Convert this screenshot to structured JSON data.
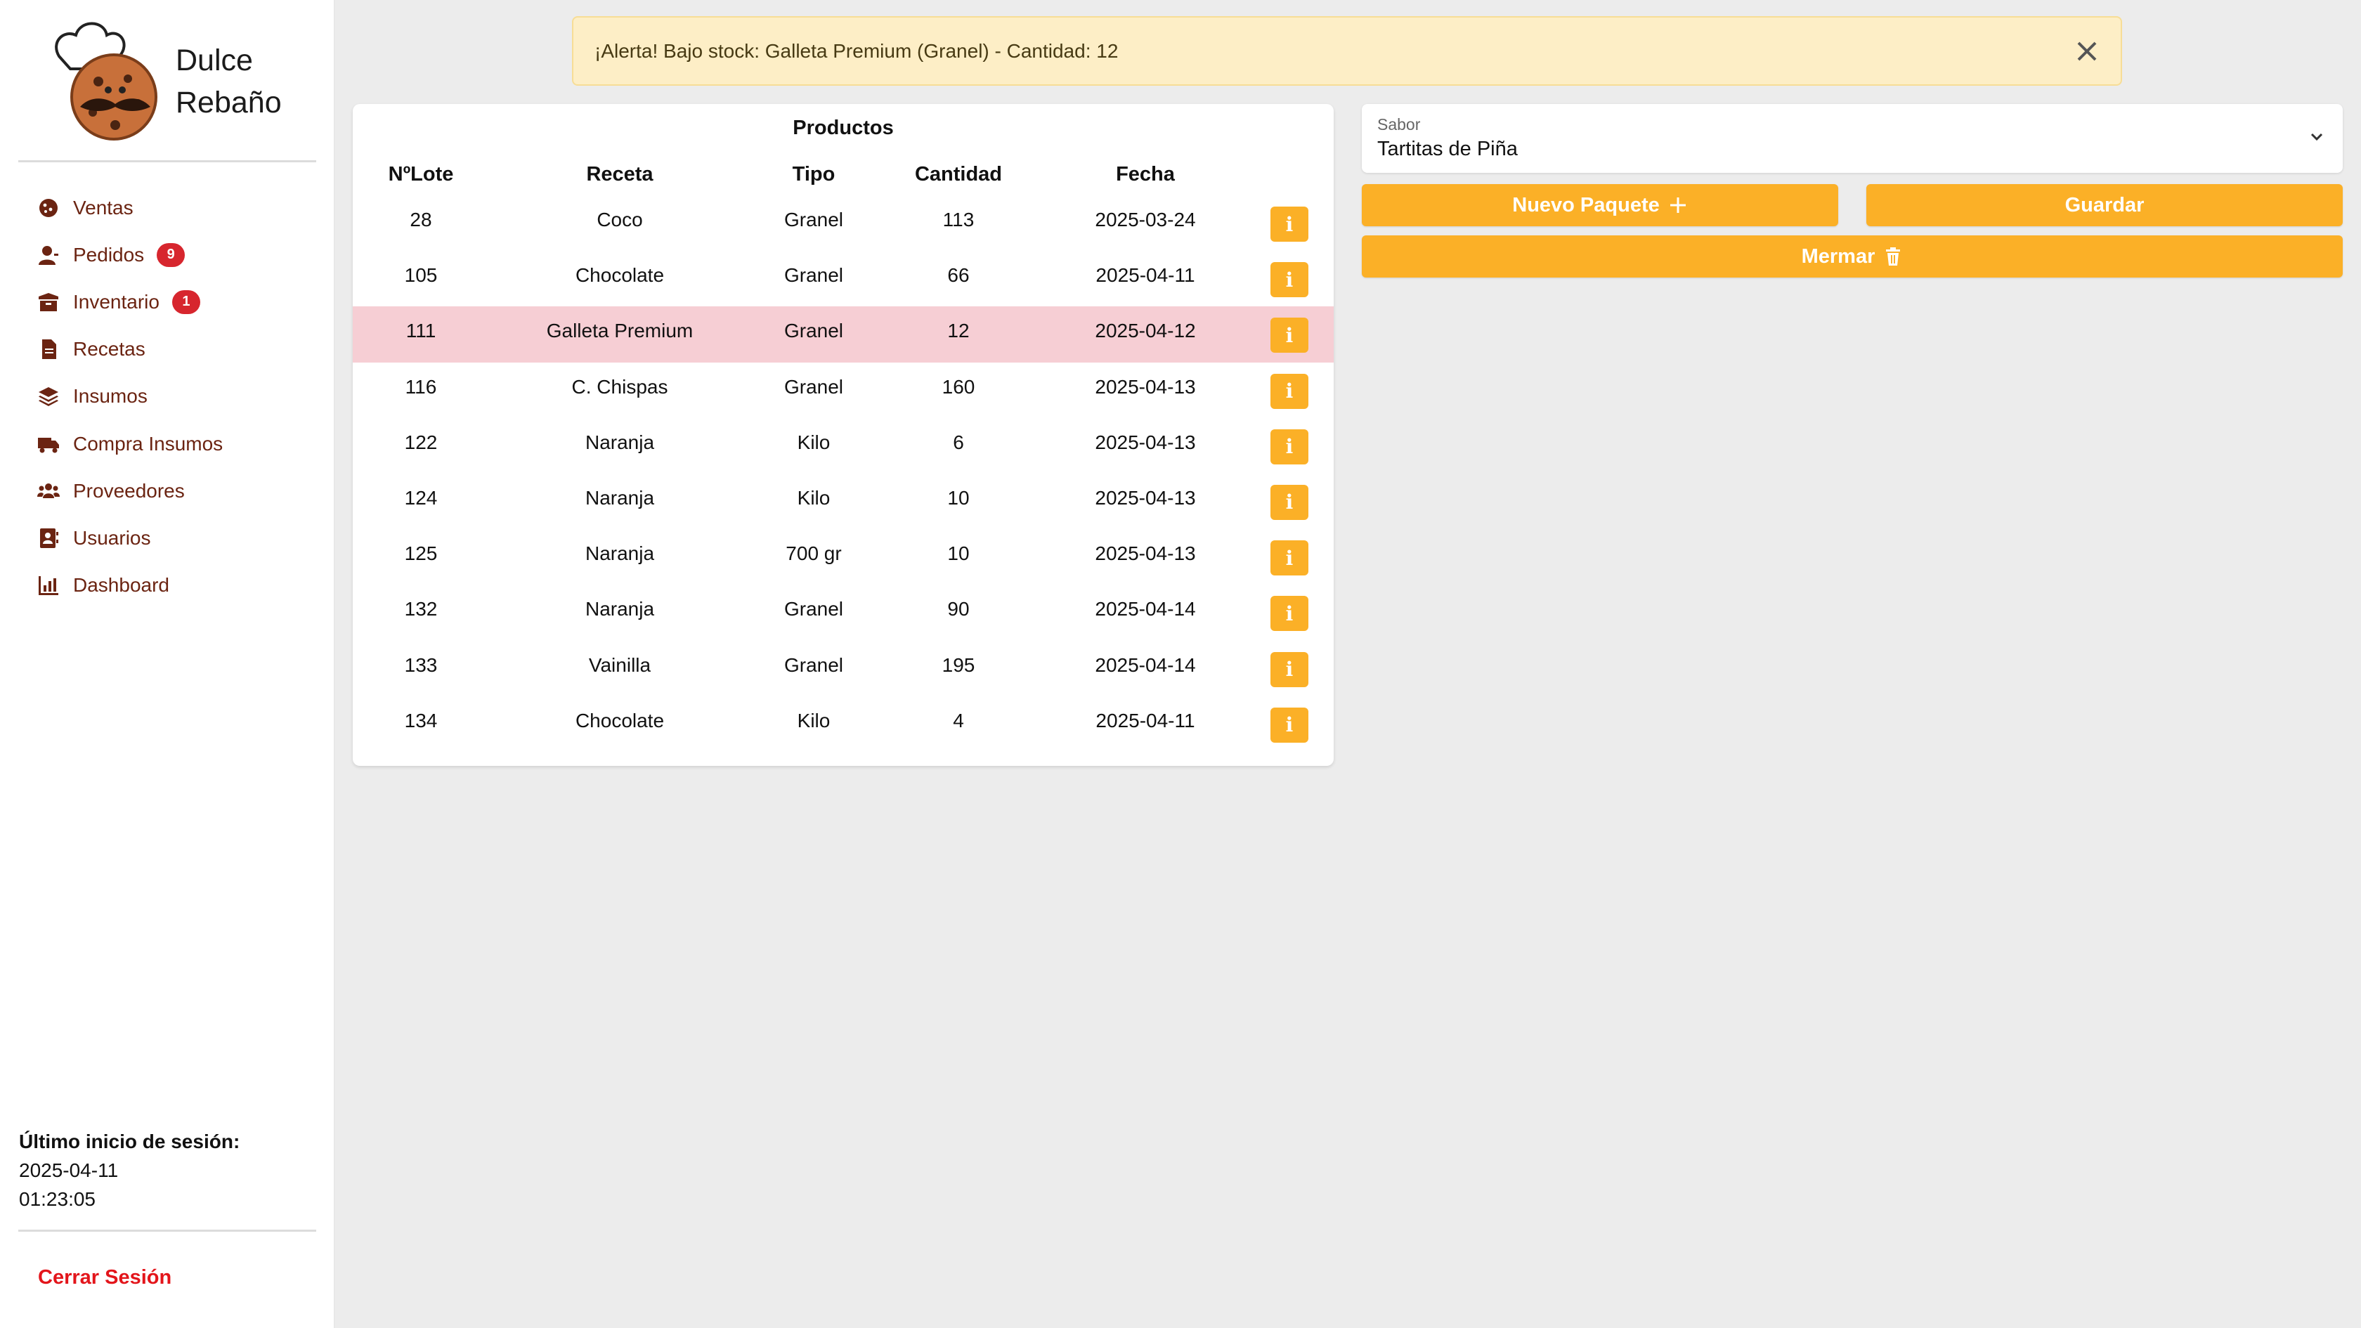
{
  "brand": {
    "line1": "Dulce",
    "line2": "Rebaño"
  },
  "nav": [
    {
      "label": "Ventas",
      "icon": "cookie-icon"
    },
    {
      "label": "Pedidos",
      "icon": "user-icon",
      "badge": "9"
    },
    {
      "label": "Inventario",
      "icon": "box-icon",
      "badge": "1"
    },
    {
      "label": "Recetas",
      "icon": "document-icon"
    },
    {
      "label": "Insumos",
      "icon": "layers-icon"
    },
    {
      "label": "Compra Insumos",
      "icon": "truck-icon"
    },
    {
      "label": "Proveedores",
      "icon": "users-icon"
    },
    {
      "label": "Usuarios",
      "icon": "address-book-icon"
    },
    {
      "label": "Dashboard",
      "icon": "chart-icon"
    }
  ],
  "session": {
    "title": "Último inicio de sesión:",
    "date": "2025-04-11",
    "time": "01:23:05"
  },
  "logout": "Cerrar Sesión",
  "alert": {
    "text": "¡Alerta! Bajo stock: Galleta Premium (Granel) - Cantidad: 12"
  },
  "table": {
    "title": "Productos",
    "headers": [
      "NºLote",
      "Receta",
      "Tipo",
      "Cantidad",
      "Fecha"
    ],
    "info_label": "i",
    "rows": [
      {
        "lote": "28",
        "receta": "Coco",
        "tipo": "Granel",
        "cantidad": "113",
        "fecha": "2025-03-24"
      },
      {
        "lote": "105",
        "receta": "Chocolate",
        "tipo": "Granel",
        "cantidad": "66",
        "fecha": "2025-04-11"
      },
      {
        "lote": "111",
        "receta": "Galleta Premium",
        "tipo": "Granel",
        "cantidad": "12",
        "fecha": "2025-04-12",
        "low_stock": true
      },
      {
        "lote": "116",
        "receta": "C. Chispas",
        "tipo": "Granel",
        "cantidad": "160",
        "fecha": "2025-04-13"
      },
      {
        "lote": "122",
        "receta": "Naranja",
        "tipo": "Kilo",
        "cantidad": "6",
        "fecha": "2025-04-13"
      },
      {
        "lote": "124",
        "receta": "Naranja",
        "tipo": "Kilo",
        "cantidad": "10",
        "fecha": "2025-04-13"
      },
      {
        "lote": "125",
        "receta": "Naranja",
        "tipo": "700 gr",
        "cantidad": "10",
        "fecha": "2025-04-13"
      },
      {
        "lote": "132",
        "receta": "Naranja",
        "tipo": "Granel",
        "cantidad": "90",
        "fecha": "2025-04-14"
      },
      {
        "lote": "133",
        "receta": "Vainilla",
        "tipo": "Granel",
        "cantidad": "195",
        "fecha": "2025-04-14"
      },
      {
        "lote": "134",
        "receta": "Chocolate",
        "tipo": "Kilo",
        "cantidad": "4",
        "fecha": "2025-04-11"
      }
    ]
  },
  "form": {
    "sabor_label": "Sabor",
    "sabor_value": "Tartitas de Piña",
    "nuevo_paquete": "Nuevo Paquete",
    "guardar": "Guardar",
    "mermar": "Mermar"
  },
  "colors": {
    "accent": "#fbb027",
    "brown": "#6b2412",
    "alert_bg": "#fdeec6",
    "low_row": "#f6ced4",
    "badge": "#d7262e",
    "logout": "#e3151b"
  }
}
